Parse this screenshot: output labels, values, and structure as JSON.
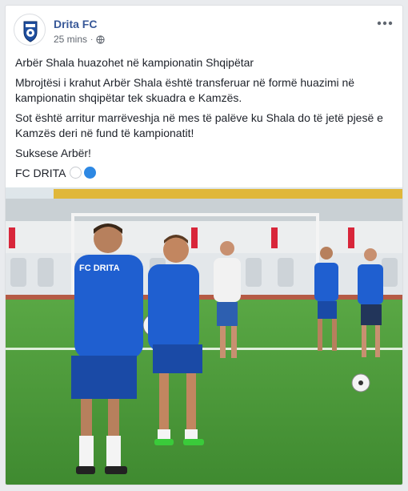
{
  "post": {
    "page_name": "Drita FC",
    "timestamp": "25 mins",
    "separator": "·",
    "avatar_alt": "Drita FC crest",
    "text": {
      "line1": "Arbër Shala huazohet në kampionatin Shqipëtar",
      "line2": "Mbrojtësi i krahut Arbër Shala është transferuar në formë huazimi në kampionatin shqipëtar tek skuadra e Kamzës.",
      "line3": "Sot është arritur marrëveshja në mes të palëve ku Shala do të jetë pjesë e Kamzës deri në fund të kampionatit!",
      "line4": "Suksese Arbër!",
      "line5": "FC DRITA"
    },
    "photo": {
      "jersey_text": "FC DRITA"
    }
  },
  "icons": {
    "privacy": "globe-icon",
    "menu": "more-options-icon",
    "emoji_1": "white-circle-emoji",
    "emoji_2": "blue-circle-emoji"
  },
  "colors": {
    "link": "#385898",
    "text": "#1d2129",
    "meta": "#616770",
    "jersey": "#1f5fd0",
    "pitch": "#4f9a3c"
  }
}
